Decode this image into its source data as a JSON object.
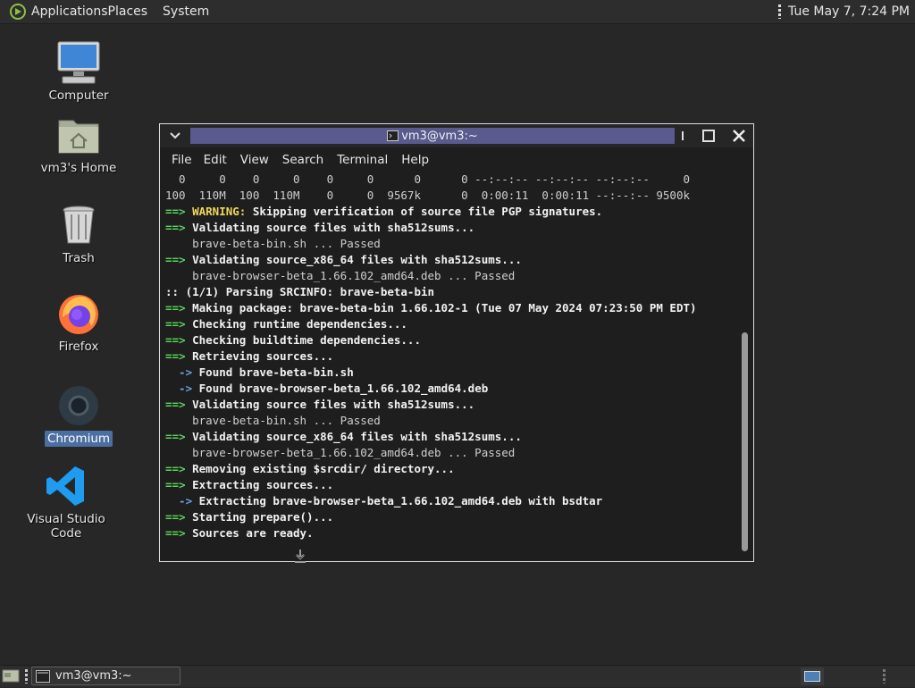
{
  "top_panel": {
    "menus": [
      "Applications",
      "Places",
      "System"
    ],
    "clock": "Tue May 7,  7:24 PM"
  },
  "desktop_icons": [
    {
      "label": "Computer",
      "icon": "computer-icon"
    },
    {
      "label": "vm3's Home",
      "icon": "home-folder-icon"
    },
    {
      "label": "Trash",
      "icon": "trash-icon"
    },
    {
      "label": "Firefox",
      "icon": "firefox-icon"
    },
    {
      "label": "Chromium",
      "icon": "chromium-icon",
      "selected": true
    },
    {
      "label": "Visual Studio Code",
      "icon": "vscode-icon"
    }
  ],
  "terminal": {
    "title": "vm3@vm3:~",
    "menu": [
      "File",
      "Edit",
      "View",
      "Search",
      "Terminal",
      "Help"
    ],
    "lines": [
      [
        {
          "t": "  0     0    0     0    0     0      0      0 --:--:-- --:--:-- --:--:--     0",
          "c": "dim"
        }
      ],
      [
        {
          "t": "100  110M  100  110M    0     0  9567k      0  0:00:11  0:00:11 --:--:-- 9500k",
          "c": "dim"
        }
      ],
      [
        {
          "t": "==> ",
          "c": "arrow"
        },
        {
          "t": "WARNING:",
          "c": "warn"
        },
        {
          "t": " Skipping verification of source file PGP signatures.",
          "c": "bold"
        }
      ],
      [
        {
          "t": "==> ",
          "c": "arrow"
        },
        {
          "t": "Validating source files with sha512sums...",
          "c": "bold"
        }
      ],
      [
        {
          "t": "    brave-beta-bin.sh ... Passed",
          "c": "dim"
        }
      ],
      [
        {
          "t": "==> ",
          "c": "arrow"
        },
        {
          "t": "Validating source_x86_64 files with sha512sums...",
          "c": "bold"
        }
      ],
      [
        {
          "t": "    brave-browser-beta_1.66.102_amd64.deb ... Passed",
          "c": "dim"
        }
      ],
      [
        {
          "t": ":: (1/1) Parsing SRCINFO: brave-beta-bin",
          "c": "bold"
        }
      ],
      [
        {
          "t": "==> ",
          "c": "arrow"
        },
        {
          "t": "Making package: brave-beta-bin 1.66.102-1 (Tue 07 May 2024 07:23:50 PM EDT)",
          "c": "bold"
        }
      ],
      [
        {
          "t": "==> ",
          "c": "arrow"
        },
        {
          "t": "Checking runtime dependencies...",
          "c": "bold"
        }
      ],
      [
        {
          "t": "==> ",
          "c": "arrow"
        },
        {
          "t": "Checking buildtime dependencies...",
          "c": "bold"
        }
      ],
      [
        {
          "t": "==> ",
          "c": "arrow"
        },
        {
          "t": "Retrieving sources...",
          "c": "bold"
        }
      ],
      [
        {
          "t": "  -> ",
          "c": "blue"
        },
        {
          "t": "Found brave-beta-bin.sh",
          "c": "bold"
        }
      ],
      [
        {
          "t": "  -> ",
          "c": "blue"
        },
        {
          "t": "Found brave-browser-beta_1.66.102_amd64.deb",
          "c": "bold"
        }
      ],
      [
        {
          "t": "==> ",
          "c": "arrow"
        },
        {
          "t": "Validating source files with sha512sums...",
          "c": "bold"
        }
      ],
      [
        {
          "t": "    brave-beta-bin.sh ... Passed",
          "c": "dim"
        }
      ],
      [
        {
          "t": "==> ",
          "c": "arrow"
        },
        {
          "t": "Validating source_x86_64 files with sha512sums...",
          "c": "bold"
        }
      ],
      [
        {
          "t": "    brave-browser-beta_1.66.102_amd64.deb ... Passed",
          "c": "dim"
        }
      ],
      [
        {
          "t": "==> ",
          "c": "arrow"
        },
        {
          "t": "Removing existing $srcdir/ directory...",
          "c": "bold"
        }
      ],
      [
        {
          "t": "==> ",
          "c": "arrow"
        },
        {
          "t": "Extracting sources...",
          "c": "bold"
        }
      ],
      [
        {
          "t": "  -> ",
          "c": "blue"
        },
        {
          "t": "Extracting brave-browser-beta_1.66.102_amd64.deb with bsdtar",
          "c": "bold"
        }
      ],
      [
        {
          "t": "==> ",
          "c": "arrow"
        },
        {
          "t": "Starting prepare()...",
          "c": "bold"
        }
      ],
      [
        {
          "t": "==> ",
          "c": "arrow"
        },
        {
          "t": "Sources are ready.",
          "c": "bold"
        }
      ]
    ]
  },
  "taskbar": {
    "task_label": "vm3@vm3:~"
  },
  "colors": {
    "arrow": "#5bd45b",
    "warning": "#f0d75a",
    "sub_arrow": "#6ea1e0",
    "title_bar": "#5a5a8e",
    "selection": "#4a6fa0"
  }
}
